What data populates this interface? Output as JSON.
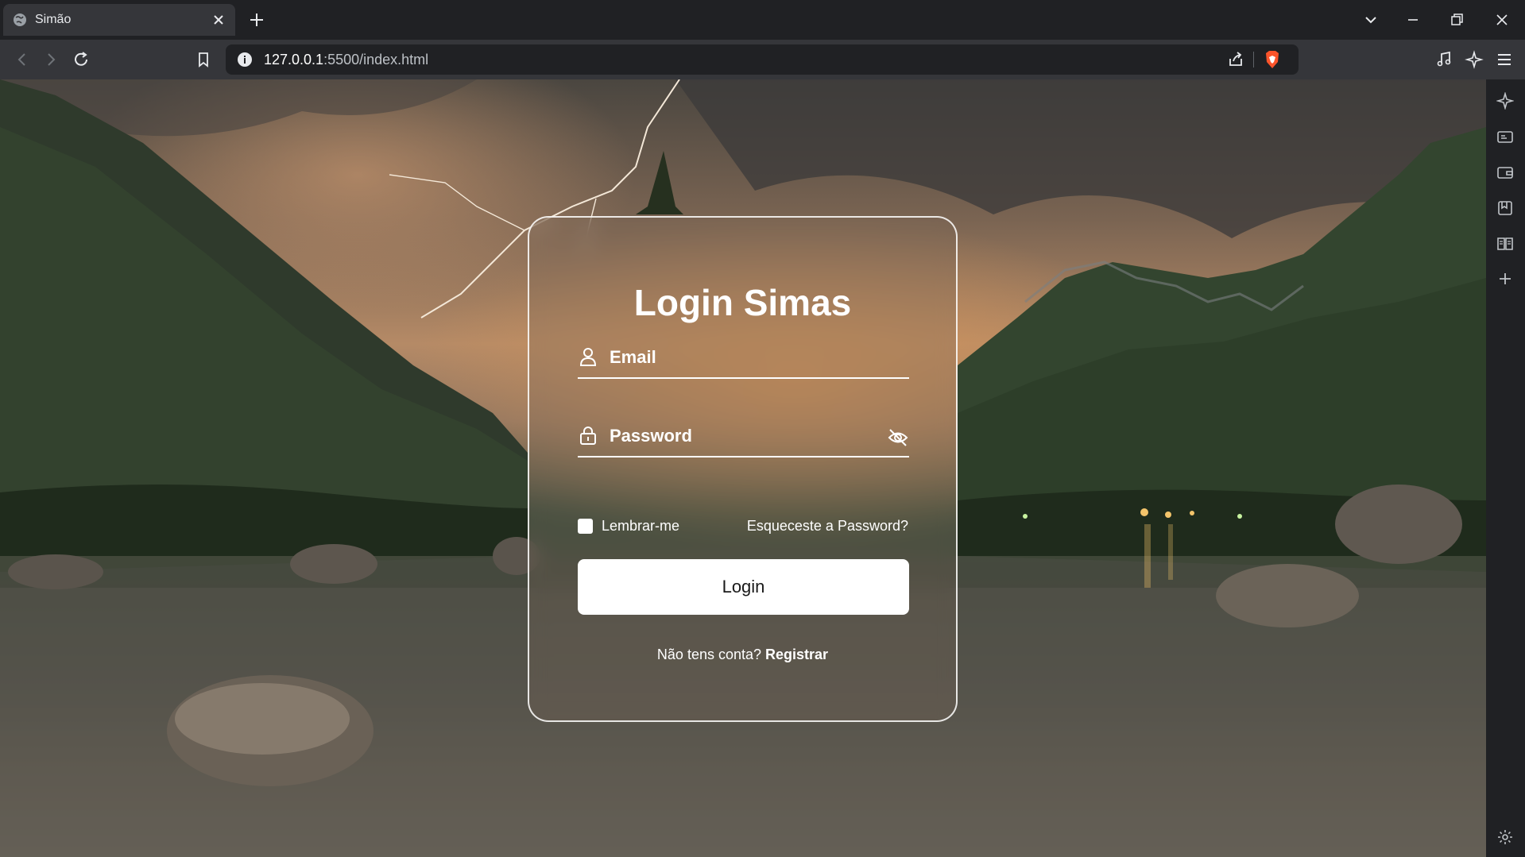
{
  "browser": {
    "tab_title": "Simão",
    "url_host": "127.0.0.1",
    "url_path": ":5500/index.html"
  },
  "login": {
    "title": "Login Simas",
    "email_placeholder": "Email",
    "password_placeholder": "Password",
    "remember_label": "Lembrar-me",
    "forgot_label": "Esqueceste a Password?",
    "button_label": "Login",
    "register_prompt": "Não tens conta?",
    "register_link": "Registrar"
  },
  "colors": {
    "chrome_dark": "#202124",
    "chrome_toolbar": "#35363a",
    "card_border": "#ffffff",
    "button_bg": "#ffffff",
    "brave_orange": "#fb542b"
  }
}
